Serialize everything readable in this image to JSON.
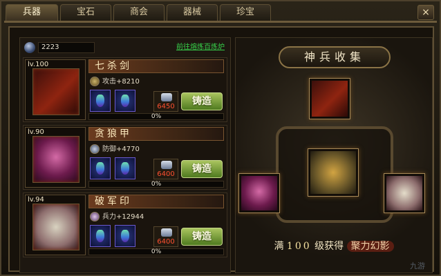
{
  "tabs": [
    {
      "label": "兵器",
      "active": true
    },
    {
      "label": "宝石",
      "active": false
    },
    {
      "label": "商会",
      "active": false
    },
    {
      "label": "器械",
      "active": false
    },
    {
      "label": "珍宝",
      "active": false
    }
  ],
  "close_label": "×",
  "currency": {
    "icon": "gem-icon",
    "amount": "2223"
  },
  "forge_link": "前往熔炼百炼炉",
  "weapons": [
    {
      "level": "lv.100",
      "name": "七杀剑",
      "stat_label": "攻击",
      "stat_value": "+8210",
      "cost": "6450",
      "forge_label": "铸造",
      "progress": "0%",
      "icon": "sword-icon"
    },
    {
      "level": "lv.90",
      "name": "贪狼甲",
      "stat_label": "防御",
      "stat_value": "+4770",
      "cost": "6400",
      "forge_label": "铸造",
      "progress": "0%",
      "icon": "armor-icon"
    },
    {
      "level": "lv.94",
      "name": "破军印",
      "stat_label": "兵力",
      "stat_value": "+12944",
      "cost": "6400",
      "forge_label": "铸造",
      "progress": "0%",
      "icon": "seal-icon"
    }
  ],
  "collection": {
    "title": "神兵收集",
    "reward_prefix": "满",
    "reward_level": "100",
    "reward_mid": "级获得",
    "reward_badge": "聚力幻影"
  },
  "watermark": "九游"
}
